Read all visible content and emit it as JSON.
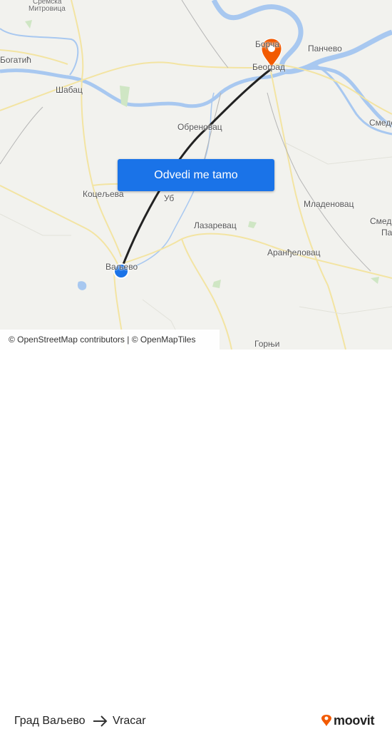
{
  "map": {
    "places": [
      {
        "id": "sremska",
        "text": "Сремска"
      },
      {
        "id": "mitrovica",
        "text": "Митровица"
      },
      {
        "id": "borca",
        "text": "Борча"
      },
      {
        "id": "pancevo",
        "text": "Панчево"
      },
      {
        "id": "bogatic",
        "text": "Богатић"
      },
      {
        "id": "beograd",
        "text": "Београд"
      },
      {
        "id": "sabac",
        "text": "Шабац"
      },
      {
        "id": "smederevo",
        "text": "Смедерево"
      },
      {
        "id": "obrenovac",
        "text": "Обреновац"
      },
      {
        "id": "koceljeva",
        "text": "Коцељева"
      },
      {
        "id": "ub",
        "text": "Уб"
      },
      {
        "id": "mladenovac",
        "text": "Младеновац"
      },
      {
        "id": "smed2a",
        "text": "Смед"
      },
      {
        "id": "smed2b",
        "text": "Па"
      },
      {
        "id": "lazarevac",
        "text": "Лазаревац"
      },
      {
        "id": "arandjelovac",
        "text": "Аранђеловац"
      },
      {
        "id": "valjevo",
        "text": "Ваљево"
      },
      {
        "id": "gornji",
        "text": "Горњи"
      }
    ],
    "cta_label": "Odvedi me tamo",
    "attribution": "© OpenStreetMap contributors | © OpenMapTiles",
    "colors": {
      "route": "#222222",
      "origin": "#1a73e8",
      "destination": "#f25a00",
      "water": "#a8c8f0",
      "cta": "#1a73e8"
    }
  },
  "footer": {
    "from": "Град Ваљево",
    "to": "Vracar",
    "brand": "moovit"
  }
}
